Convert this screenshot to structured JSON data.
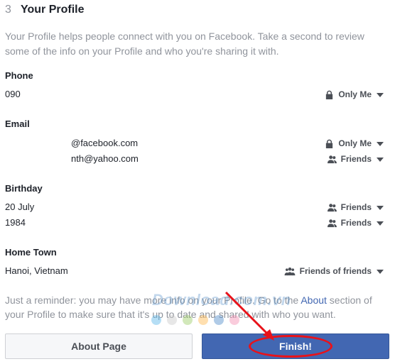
{
  "header": {
    "step": "3",
    "title": "Your Profile"
  },
  "intro": "Your Profile helps people connect with you on Facebook. Take a second to review some of the info on your Profile and who you're sharing it with.",
  "sections": {
    "phone": {
      "label": "Phone",
      "values": [
        {
          "text": "090",
          "privacy": "Only Me",
          "icon": "lock-icon"
        }
      ]
    },
    "email": {
      "label": "Email",
      "values": [
        {
          "text": "@facebook.com",
          "privacy": "Only Me",
          "icon": "lock-icon"
        },
        {
          "text": "nth@yahoo.com",
          "privacy": "Friends",
          "icon": "friends-icon"
        }
      ]
    },
    "birthday": {
      "label": "Birthday",
      "values": [
        {
          "text": "20 July",
          "privacy": "Friends",
          "icon": "friends-icon"
        },
        {
          "text": "1984",
          "privacy": "Friends",
          "icon": "friends-icon"
        }
      ]
    },
    "hometown": {
      "label": "Home Town",
      "values": [
        {
          "text": "Hanoi, Vietnam",
          "privacy": "Friends of friends",
          "icon": "friends-of-friends-icon"
        }
      ]
    }
  },
  "reminder": {
    "before": "Just a reminder: you may have more info on your Profile. Go to the ",
    "link": "About",
    "after": " section of your Profile to make sure that it's up to date and shared with who you want."
  },
  "buttons": {
    "about": "About Page",
    "finish": "Finish!"
  },
  "watermark": "Download.com.vn",
  "colors": {
    "accent": "#4267b2",
    "annotation": "#e8121a"
  }
}
